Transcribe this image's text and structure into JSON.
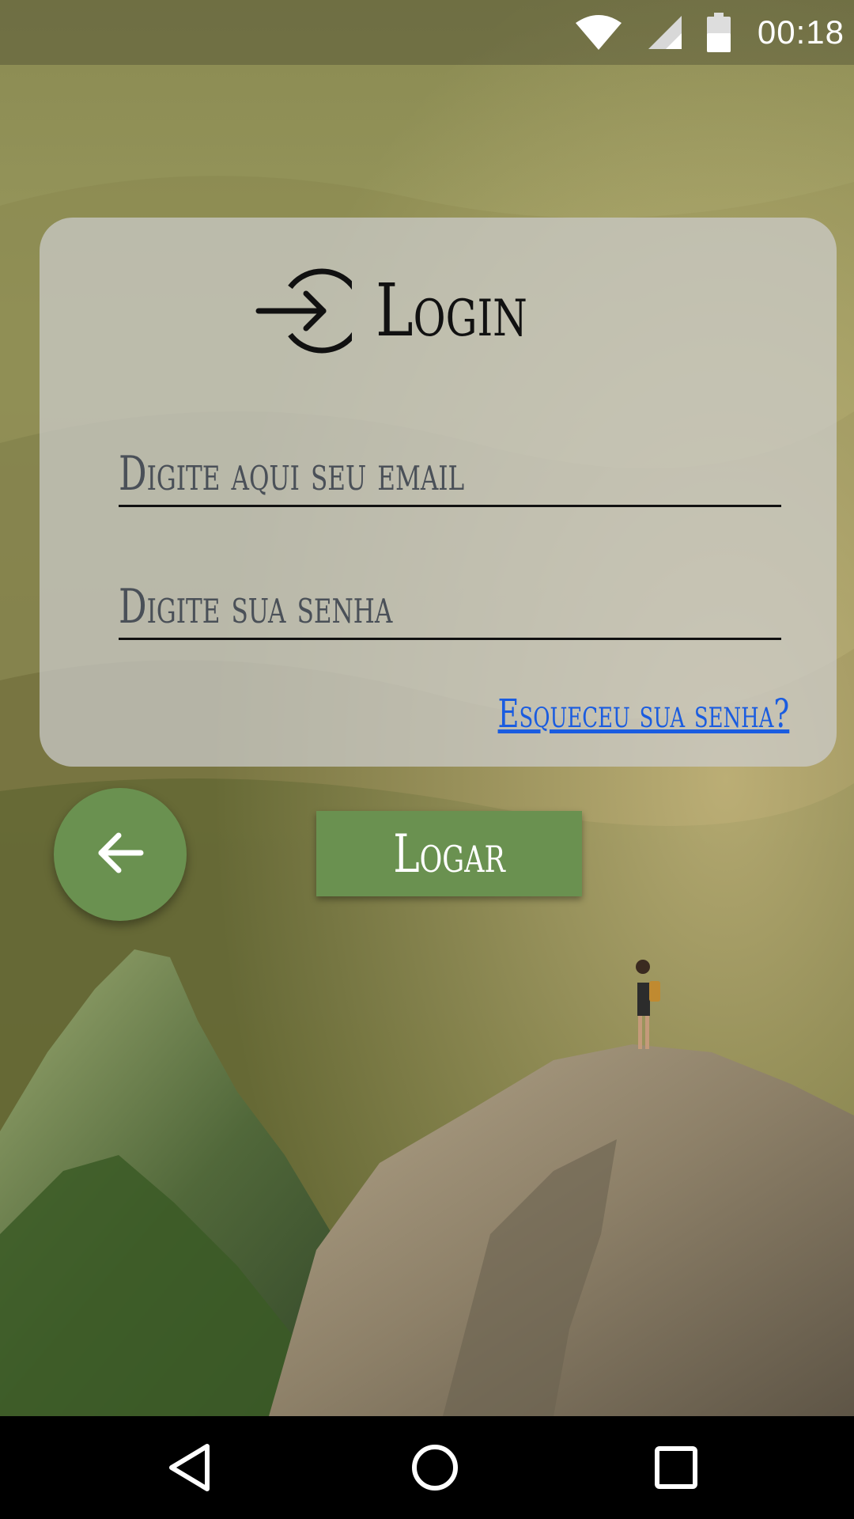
{
  "status_bar": {
    "time": "00:18",
    "icons": [
      "wifi-icon",
      "signal-icon",
      "battery-icon"
    ]
  },
  "login_card": {
    "title": "Login",
    "title_icon": "login-icon",
    "email_placeholder": "Digite aqui seu email",
    "password_placeholder": "Digite sua senha",
    "forgot_password": "Esqueceu sua senha?"
  },
  "actions": {
    "back_icon": "arrow-left-icon",
    "submit_label": "Logar"
  },
  "nav_bar": {
    "buttons": [
      "back-triangle-icon",
      "home-circle-icon",
      "recents-square-icon"
    ]
  },
  "colors": {
    "button_green": "#6a9150",
    "link_blue": "#1a5ce0",
    "card_background": "#cdcdcd"
  }
}
